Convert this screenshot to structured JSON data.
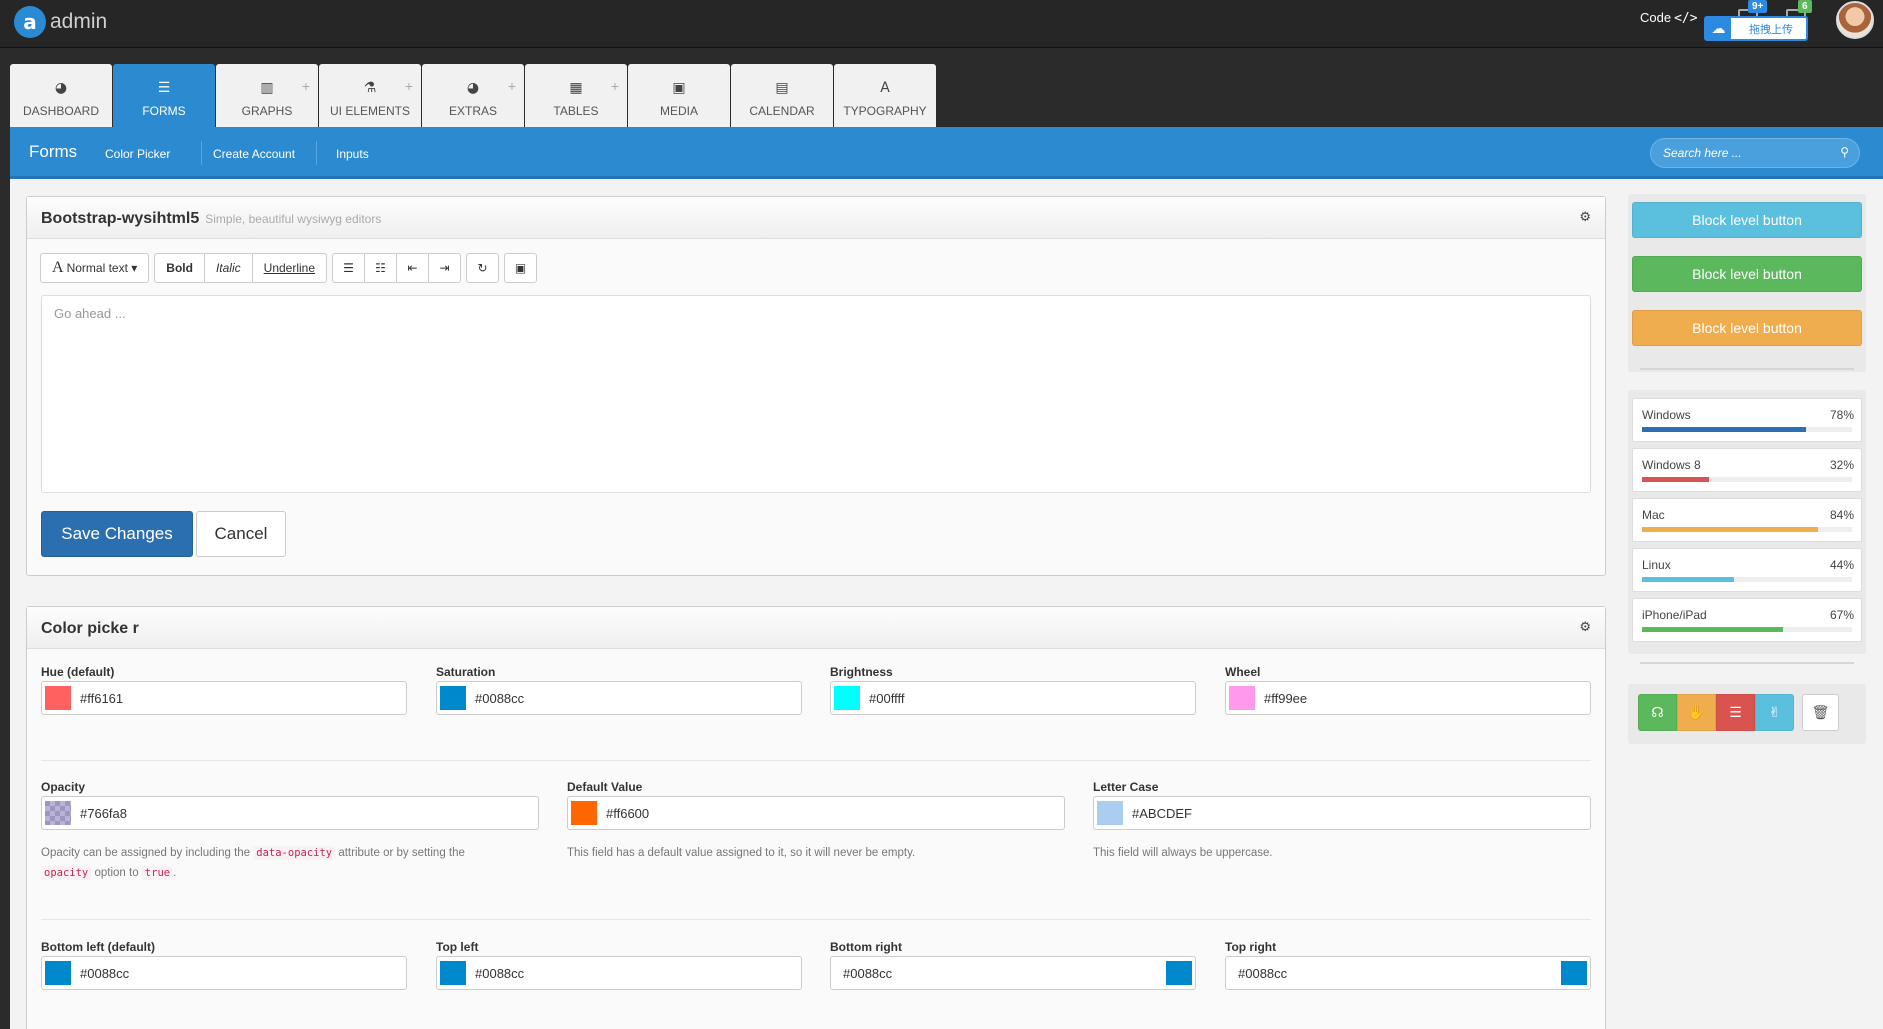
{
  "app": {
    "logo_letter": "a",
    "brand": "admin"
  },
  "topbar": {
    "code_label": "Code",
    "code_icon": "</>",
    "badge_messages": "9+",
    "badge_tasks": "6",
    "upload_label": "拖拽上传"
  },
  "nav": {
    "tabs": [
      {
        "label": "DASHBOARD",
        "icon": "dashboard-icon",
        "glyph": "◕"
      },
      {
        "label": "FORMS",
        "icon": "list-icon",
        "glyph": "☰"
      },
      {
        "label": "GRAPHS",
        "icon": "bar-chart-icon",
        "glyph": "▥"
      },
      {
        "label": "UI ELEMENTS",
        "icon": "flask-icon",
        "glyph": "⚗"
      },
      {
        "label": "EXTRAS",
        "icon": "gauge-icon",
        "glyph": "◕"
      },
      {
        "label": "TABLES",
        "icon": "table-icon",
        "glyph": "▦"
      },
      {
        "label": "MEDIA",
        "icon": "image-icon",
        "glyph": "▣"
      },
      {
        "label": "CALENDAR",
        "icon": "calendar-icon",
        "glyph": "▤"
      },
      {
        "label": "TYPOGRAPHY",
        "icon": "font-icon",
        "glyph": "A"
      }
    ],
    "plus": "+"
  },
  "subnav": {
    "title": "Forms",
    "links": [
      "Color Picker",
      "Create Account",
      "Inputs"
    ],
    "search_placeholder": "Search here ..."
  },
  "editor": {
    "title": "Bootstrap-wysihtml5",
    "subtitle": "Simple, beautiful wysiwyg editors",
    "font_glyph": "A",
    "font_button": "Normal text",
    "bold": "Bold",
    "italic": "Italic",
    "underline": "Underline",
    "placeholder": "Go ahead ...",
    "save": "Save Changes",
    "cancel": "Cancel"
  },
  "colorpicker": {
    "title": "Color picke r",
    "row1": [
      {
        "label": "Hue (default)",
        "value": "#ff6161",
        "color": "#ff6161"
      },
      {
        "label": "Saturation",
        "value": "#0088cc",
        "color": "#0088cc"
      },
      {
        "label": "Brightness",
        "value": "#00ffff",
        "color": "#00ffff"
      },
      {
        "label": "Wheel",
        "value": "#ff99ee",
        "color": "#ff99ee"
      }
    ],
    "row2": [
      {
        "label": "Opacity",
        "value": "#766fa8",
        "color": "#766fa8"
      },
      {
        "label": "Default Value",
        "value": "#ff6600",
        "color": "#ff6600"
      },
      {
        "label": "Letter Case",
        "value": "#ABCDEF",
        "color": "#abcdef"
      }
    ],
    "help_opacity": {
      "t1": "Opacity can be assigned by including the",
      "c1": "data-opacity",
      "t2": "attribute or by setting the",
      "c2": "opacity",
      "t3": "option to",
      "c3": "true",
      "t4": "."
    },
    "help_default": "This field has a default value assigned to it, so it will never be empty.",
    "help_case": "This field will always be uppercase.",
    "row3": [
      {
        "label": "Bottom left (default)",
        "value": "#0088cc",
        "color": "#0088cc"
      },
      {
        "label": "Top left",
        "value": "#0088cc",
        "color": "#0088cc"
      },
      {
        "label": "Bottom right",
        "value": "#0088cc",
        "color": "#0088cc"
      },
      {
        "label": "Top right",
        "value": "#0088cc",
        "color": "#0088cc"
      }
    ]
  },
  "sidebar": {
    "block_buttons": [
      {
        "label": "Block level button",
        "color": "#5bc0de"
      },
      {
        "label": "Block level button",
        "color": "#5cb85c"
      },
      {
        "label": "Block level button",
        "color": "#f0ad4e"
      }
    ],
    "stats": [
      {
        "name": "Windows",
        "pct": "78%",
        "value": 78,
        "color": "#2c6fb0"
      },
      {
        "name": "Windows 8",
        "pct": "32%",
        "value": 32,
        "color": "#d9534f"
      },
      {
        "name": "Mac",
        "pct": "84%",
        "value": 84,
        "color": "#f0ad4e"
      },
      {
        "name": "Linux",
        "pct": "44%",
        "value": 44,
        "color": "#5bc0de"
      },
      {
        "name": "iPhone/iPad",
        "pct": "67%",
        "value": 67,
        "color": "#5cb85c"
      }
    ],
    "actions": [
      {
        "name": "headphones-icon",
        "glyph": "☊",
        "color": "#5cb85c"
      },
      {
        "name": "thumbs-down-icon",
        "glyph": "✋",
        "color": "#f0ad4e"
      },
      {
        "name": "list-icon",
        "glyph": "☰",
        "color": "#d9534f"
      },
      {
        "name": "thumbs-up-icon",
        "glyph": "✌",
        "color": "#5bc0de"
      }
    ],
    "delete_glyph": "🗑"
  }
}
